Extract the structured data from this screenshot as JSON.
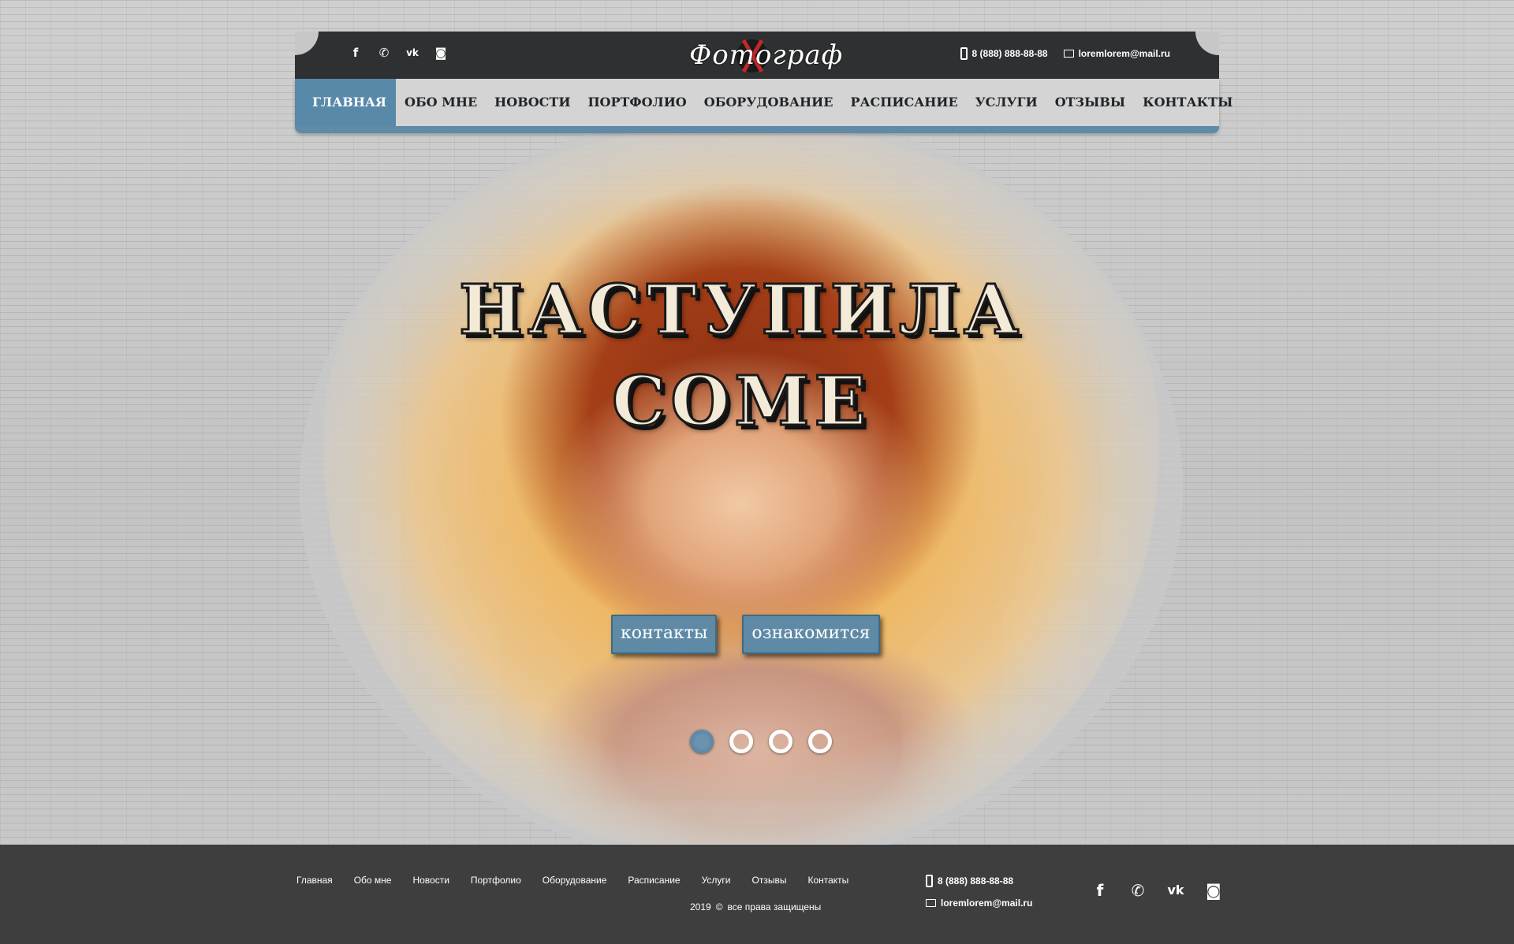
{
  "header": {
    "logo_text": "Фотограф",
    "socials": [
      {
        "icon": "facebook-icon",
        "glyph": "f"
      },
      {
        "icon": "whatsapp-icon",
        "glyph": "✆"
      },
      {
        "icon": "vk-icon",
        "glyph": "vk"
      },
      {
        "icon": "instagram-icon",
        "glyph": "◙"
      }
    ],
    "phone": "8 (888) 888-88-88",
    "email": "loremlorem@mail.ru"
  },
  "nav": {
    "items": [
      "ГЛАВНАЯ",
      "ОБО МНЕ",
      "НОВОСТИ",
      "ПОРТФОЛИО",
      "ОБОРУДОВАНИЕ",
      "РАСПИСАНИЕ",
      "УСЛУГИ",
      "ОТЗЫВЫ",
      "КОНТАКТЫ"
    ],
    "active_index": 0
  },
  "hero": {
    "line1": "НАСТУПИЛА",
    "line2": "СОМЕ",
    "button_contacts": "контакты",
    "button_learn": "ознакомится",
    "slides_count": 4,
    "active_slide": 0
  },
  "footer": {
    "nav": [
      "Главная",
      "Обо мне",
      "Новости",
      "Портфолио",
      "Оборудование",
      "Расписание",
      "Услуги",
      "Отзывы",
      "Контакты"
    ],
    "year": "2019",
    "copyright_symbol": "©",
    "rights": "все права защищены",
    "phone": "8 (888) 888-88-88",
    "email": "loremlorem@mail.ru"
  },
  "colors": {
    "accent": "#5f8aa8",
    "header_dark": "#2e3032",
    "footer": "#3e3e3e",
    "nav_bg": "#d4d4d4"
  }
}
